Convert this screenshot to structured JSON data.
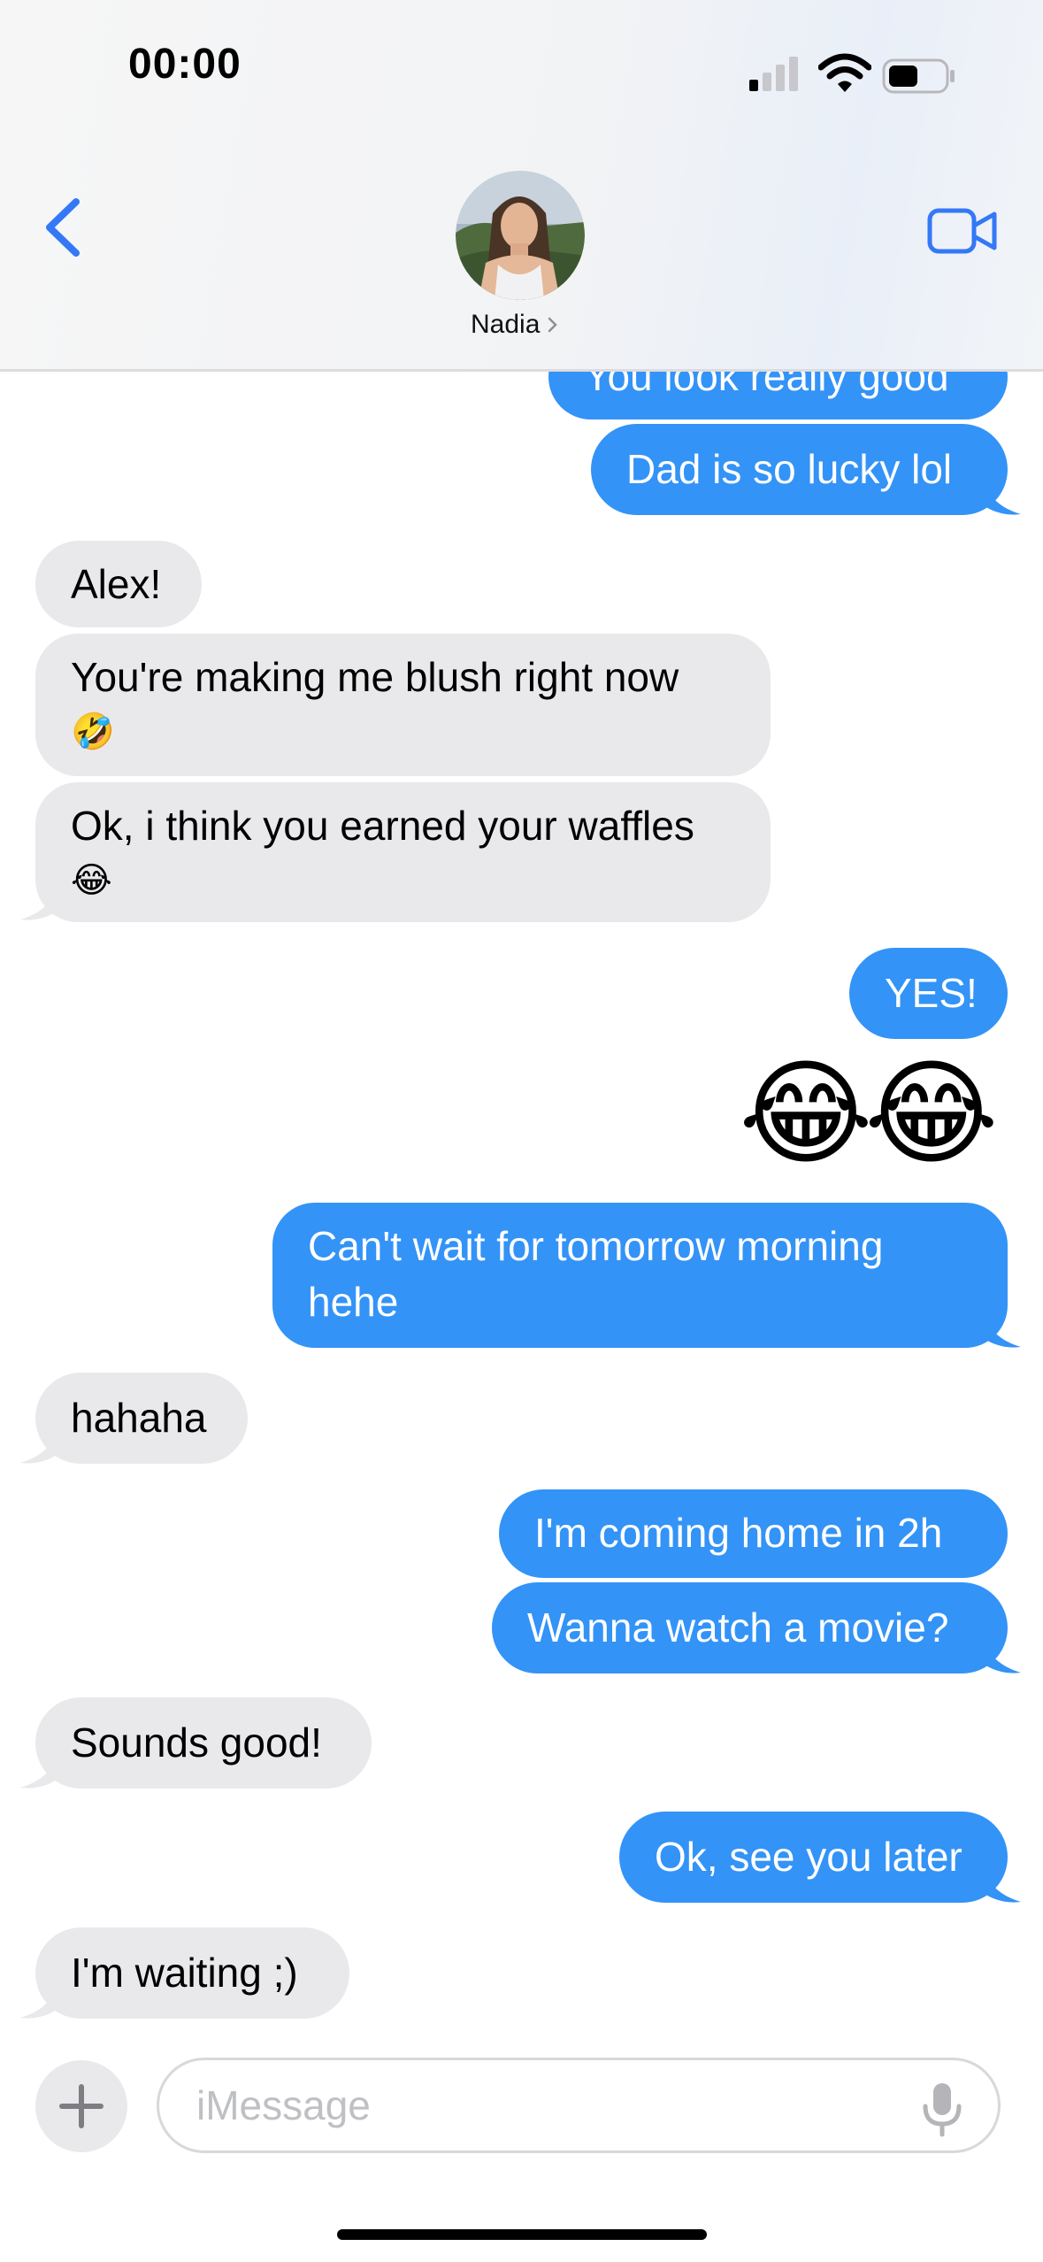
{
  "status_bar": {
    "time": "00:00"
  },
  "header": {
    "contact_name": "Nadia"
  },
  "messages": [
    {
      "direction": "out",
      "text": "You look really good"
    },
    {
      "direction": "out",
      "text": "Dad is so lucky lol"
    },
    {
      "direction": "in",
      "text": "Alex!"
    },
    {
      "direction": "in",
      "text": "You're making me blush right now",
      "emoji": "🤣"
    },
    {
      "direction": "in",
      "text": "Ok, i think you earned your waffles",
      "emoji": "😂"
    },
    {
      "direction": "out",
      "text": "YES!"
    },
    {
      "direction": "out",
      "emoji_only": "😂😂"
    },
    {
      "direction": "out",
      "line1": "Can't wait for tomorrow morning",
      "line2": "hehe"
    },
    {
      "direction": "in",
      "text": "hahaha"
    },
    {
      "direction": "out",
      "text": "I'm coming home in 2h"
    },
    {
      "direction": "out",
      "text": "Wanna watch a movie?"
    },
    {
      "direction": "in",
      "text": "Sounds good!"
    },
    {
      "direction": "out",
      "text": "Ok, see you later"
    },
    {
      "direction": "in",
      "text": "I'm waiting ;)"
    }
  ],
  "input": {
    "placeholder": "iMessage"
  },
  "colors": {
    "outgoing_bubble": "#3393f7",
    "incoming_bubble": "#e9e9eb",
    "accent": "#3478f6"
  }
}
